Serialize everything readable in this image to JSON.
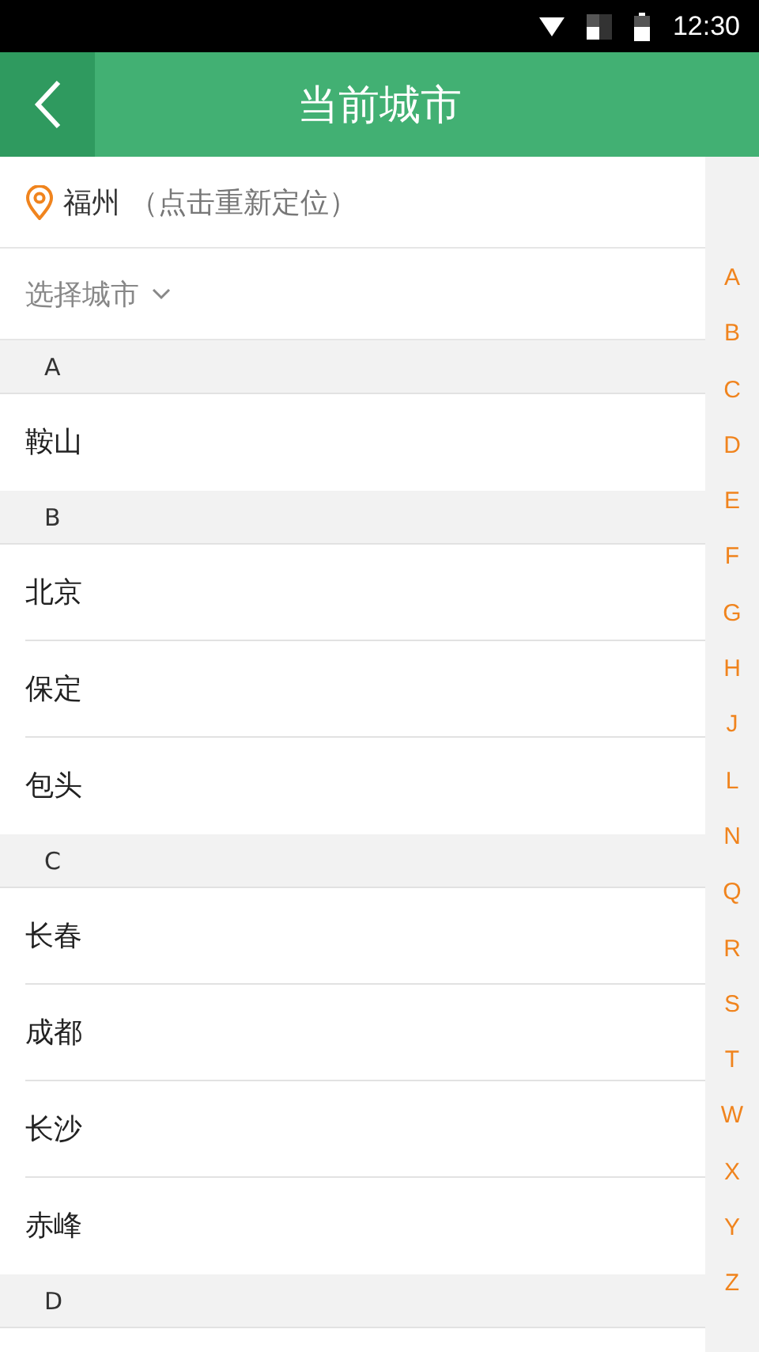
{
  "status_bar": {
    "time": "12:30"
  },
  "header": {
    "title": "当前城市"
  },
  "location": {
    "city": "福州",
    "hint": "（点击重新定位）"
  },
  "city_picker": {
    "label": "选择城市"
  },
  "sections": [
    {
      "letter": "A",
      "cities": [
        "鞍山"
      ]
    },
    {
      "letter": "B",
      "cities": [
        "北京",
        "保定",
        "包头"
      ]
    },
    {
      "letter": "C",
      "cities": [
        "长春",
        "成都",
        "长沙",
        "赤峰"
      ]
    },
    {
      "letter": "D"
    }
  ],
  "index": [
    "A",
    "B",
    "C",
    "D",
    "E",
    "F",
    "G",
    "H",
    "J",
    "L",
    "N",
    "Q",
    "R",
    "S",
    "T",
    "W",
    "X",
    "Y",
    "Z"
  ]
}
